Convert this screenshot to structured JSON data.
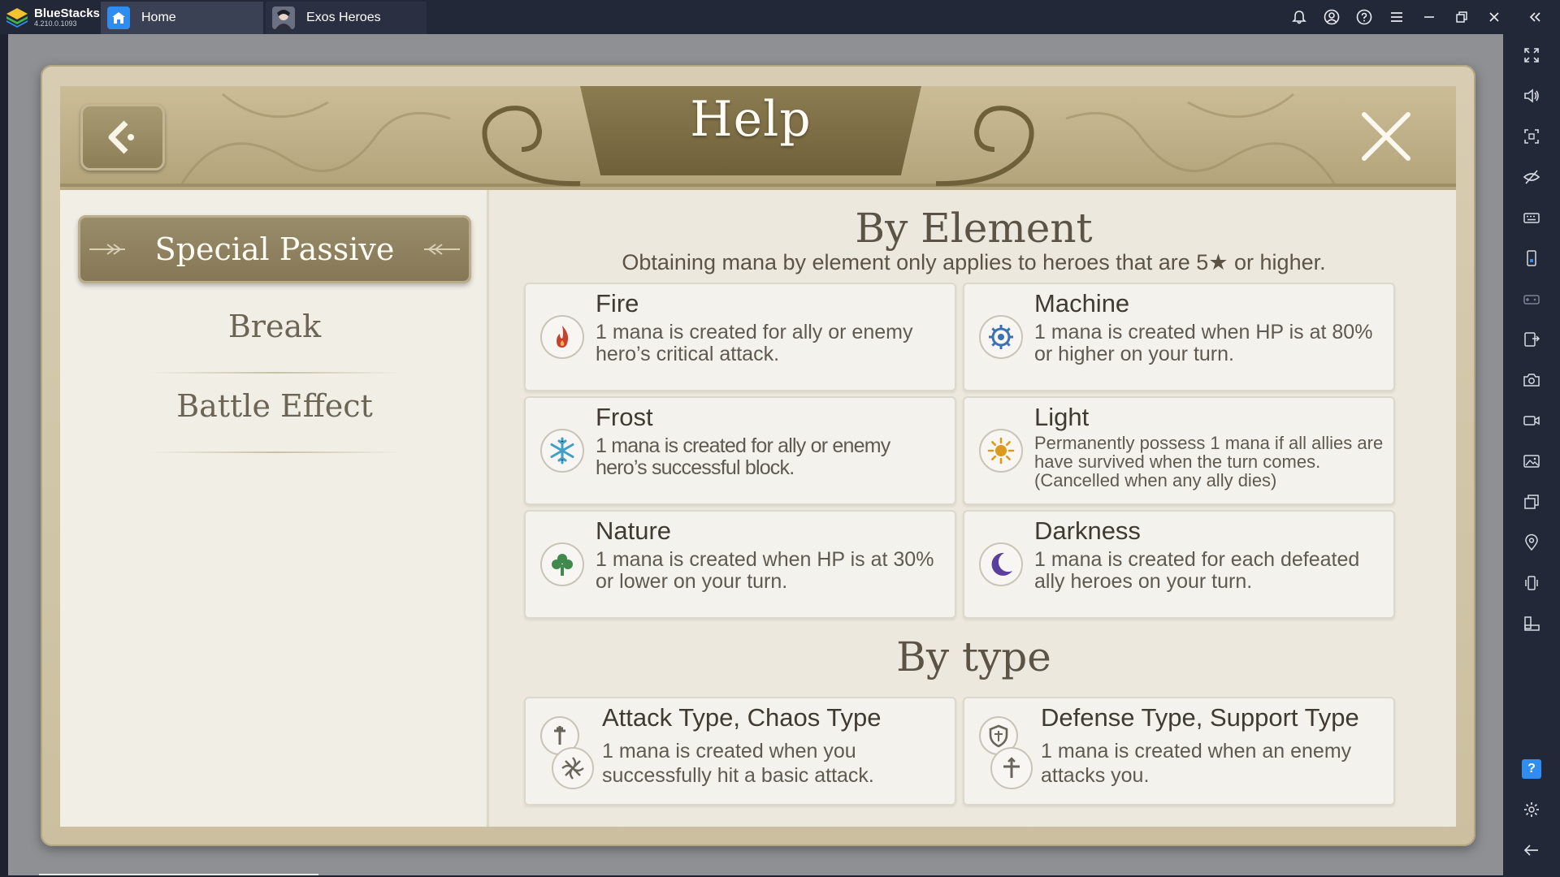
{
  "window": {
    "app_name": "BlueStacks",
    "version": "4.210.0.1093",
    "tabs": [
      {
        "label": "Home",
        "icon": "home-icon"
      },
      {
        "label": "Exos Heroes",
        "icon": "game-thumbnail"
      }
    ]
  },
  "help": {
    "title": "Help",
    "menu": [
      {
        "label": "Special Passive",
        "active": true
      },
      {
        "label": "Break",
        "active": false
      },
      {
        "label": "Battle Effect",
        "active": false
      }
    ],
    "by_element": {
      "title": "By Element",
      "note": "Obtaining mana by element only applies to heroes that are 5★ or higher.",
      "cards": [
        {
          "title": "Fire",
          "text": "1 mana is created for ally or enemy hero’s critical attack.",
          "icon": "fire-icon",
          "color": "#c9402f"
        },
        {
          "title": "Machine",
          "text": "1 mana is created when HP is at 80% or higher on your turn.",
          "icon": "gear-icon",
          "color": "#3d6fb3"
        },
        {
          "title": "Frost",
          "text": "1 mana is created for ally or enemy hero’s successful block.",
          "icon": "snowflake-icon",
          "color": "#3f9fc6"
        },
        {
          "title": "Light",
          "text": "Permanently possess 1 mana if all allies are have survived when the turn comes.(Cancelled when any ally dies)",
          "icon": "sun-icon",
          "color": "#d99a1e"
        },
        {
          "title": "Nature",
          "text": "1 mana is created when HP is at 30% or lower on your turn.",
          "icon": "tree-icon",
          "color": "#3f8a4c"
        },
        {
          "title": "Darkness",
          "text": "1 mana is created for each defeated ally heroes on your turn.",
          "icon": "moon-icon",
          "color": "#5a3f9e"
        }
      ]
    },
    "by_type": {
      "title": "By type",
      "cards": [
        {
          "title": "Attack Type, Chaos Type",
          "text": "1 mana is created when you successfully hit a basic attack.",
          "icon": "sword-icon"
        },
        {
          "title": "Defense Type, Support Type",
          "text": "1 mana is created when an enemy attacks you.",
          "icon": "shield-icon"
        }
      ]
    }
  }
}
